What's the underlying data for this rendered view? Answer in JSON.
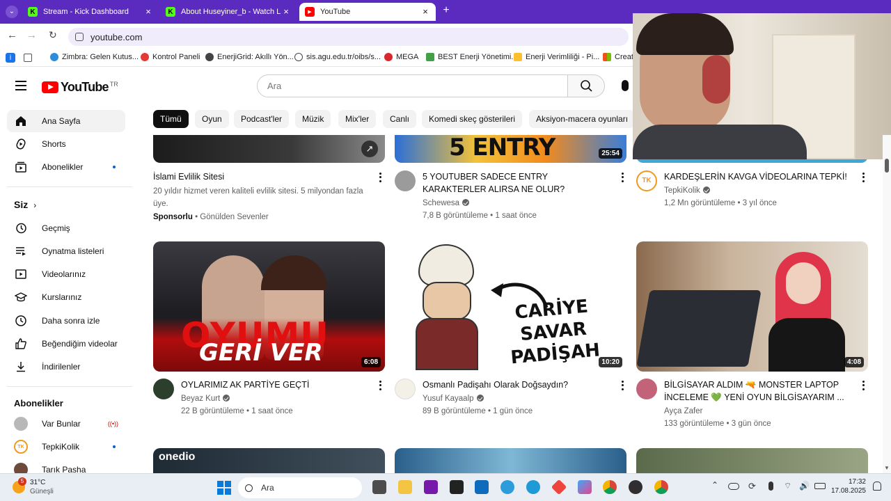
{
  "browser": {
    "tabs": [
      {
        "title": "Stream - Kick Dashboard",
        "favicon": "K"
      },
      {
        "title": "About Huseyiner_b - Watch Live",
        "favicon": "K"
      },
      {
        "title": "YouTube",
        "favicon": "▶"
      }
    ],
    "new_tab_label": "+",
    "address": "youtube.com",
    "bookmarks": [
      "Zimbra: Gelen Kutus...",
      "Kontrol Paneli",
      "EnerjiGrid: Akıllı Yön...",
      "sis.agu.edu.tr/oibs/s...",
      "MEGA",
      "BEST Enerji Yönetimi...",
      "Enerji Verimliliği - Pi...",
      "Creat"
    ]
  },
  "masthead": {
    "logo_text": "YouTube",
    "region": "TR",
    "search_placeholder": "Ara"
  },
  "chips": [
    "Tümü",
    "Oyun",
    "Podcast'ler",
    "Müzik",
    "Mix'ler",
    "Canlı",
    "Komedi skeç gösterileri",
    "Aksiyon-macera oyunları"
  ],
  "sidebar": {
    "main": [
      {
        "label": "Ana Sayfa",
        "icon": "home-icon"
      },
      {
        "label": "Shorts",
        "icon": "shorts-icon"
      },
      {
        "label": "Abonelikler",
        "icon": "subscriptions-icon"
      }
    ],
    "you_title": "Siz",
    "you_items": [
      {
        "label": "Geçmiş",
        "icon": "history-icon"
      },
      {
        "label": "Oynatma listeleri",
        "icon": "playlist-icon"
      },
      {
        "label": "Videolarınız",
        "icon": "your-videos-icon"
      },
      {
        "label": "Kurslarınız",
        "icon": "courses-icon"
      },
      {
        "label": "Daha sonra izle",
        "icon": "watch-later-icon"
      },
      {
        "label": "Beğendiğim videolar",
        "icon": "like-icon"
      },
      {
        "label": "İndirilenler",
        "icon": "download-icon"
      }
    ],
    "subs_title": "Abonelikler",
    "subs": [
      {
        "label": "Var Bunlar",
        "status": "live"
      },
      {
        "label": "TepkiKolik",
        "status": "new"
      },
      {
        "label": "Tarık Pasha",
        "status": ""
      }
    ]
  },
  "videos_row1": [
    {
      "title": "İslami Evlilik Sitesi",
      "desc": "20 yıldır hizmet veren kaliteli evlilik sitesi. 5 milyondan fazla üye.",
      "sponsor": "Sponsorlu",
      "advertiser": "Gönülden Sevenler"
    },
    {
      "title": "5 YOUTUBER SADECE ENTRY KARAKTERLER ALIRSA NE OLUR?",
      "channel": "Schewesa",
      "meta": "7,8 B görüntüleme • 1 saat önce",
      "duration": "25:54",
      "thumb_text": "5 ENTRY"
    },
    {
      "title": "KARDEŞLERİN KAVGA VİDEOLARINA TEPKİ!",
      "channel": "TepkiKolik",
      "meta": "1,2 Mn görüntüleme • 3 yıl önce",
      "avatar_text": "TK"
    }
  ],
  "videos_row2": [
    {
      "title": "OYLARIMIZ AK PARTİYE GEÇTİ",
      "channel": "Beyaz Kurt",
      "meta": "22 B görüntüleme • 1 saat önce",
      "duration": "6:08",
      "thumb_text": "OYUMU",
      "thumb_text2": "GERİ VER"
    },
    {
      "title": "Osmanlı Padişahı Olarak Doğsaydın?",
      "channel": "Yusuf Kayaalp",
      "meta": "89 B görüntüleme • 1 gün önce",
      "duration": "10:20",
      "thumb_text": "CARİYE SAVAR PADİŞAH"
    },
    {
      "title": "BİLGİSAYAR ALDIM 🔫 MONSTER LAPTOP İNCELEME 💚 YENİ OYUN BİLGİSAYARIM ...",
      "channel": "Ayça Zafer",
      "meta": "133 görüntüleme • 3 gün önce",
      "duration": "4:08"
    }
  ],
  "row3_thumb_text": "onedio",
  "taskbar": {
    "weather_temp": "31°C",
    "weather_desc": "Güneşli",
    "weather_badge": "5",
    "search_label": "Ara",
    "time": "17:32",
    "date": "17.08.2025"
  },
  "colors": {
    "tabstrip": "#5b2bbf",
    "yt_red": "#ff0000",
    "link_blue": "#065fd4"
  }
}
